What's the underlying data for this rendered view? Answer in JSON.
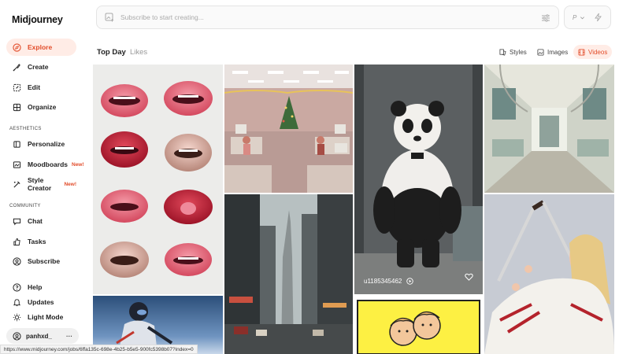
{
  "app": {
    "logo": "Midjourney"
  },
  "nav": {
    "explore": "Explore",
    "create": "Create",
    "edit": "Edit",
    "organize": "Organize",
    "aesthetics_label": "AESTHETICS",
    "personalize": "Personalize",
    "moodboards": "Moodboards",
    "moodboards_badge": "New!",
    "style_creator": "Style Creator",
    "style_creator_badge": "New!",
    "community_label": "COMMUNITY",
    "chat": "Chat",
    "tasks": "Tasks",
    "subscribe": "Subscribe",
    "help": "Help",
    "updates": "Updates",
    "light_mode": "Light Mode",
    "username": "panhxd_",
    "more": "···"
  },
  "search": {
    "placeholder": "Subscribe to start creating...",
    "p_label": "P"
  },
  "tabs": {
    "top_day": "Top Day",
    "likes": "Likes"
  },
  "filters": {
    "styles": "Styles",
    "images": "Images",
    "videos": "Videos"
  },
  "tiles": {
    "panda_user": "u1185345462"
  },
  "status_url": "https://www.midjourney.com/jobs/6ffa135c-698e-4b25-b5e5-900fc5398b07?index=0",
  "colors": {
    "accent": "#e24c2a",
    "active_bg": "#ffece6"
  }
}
